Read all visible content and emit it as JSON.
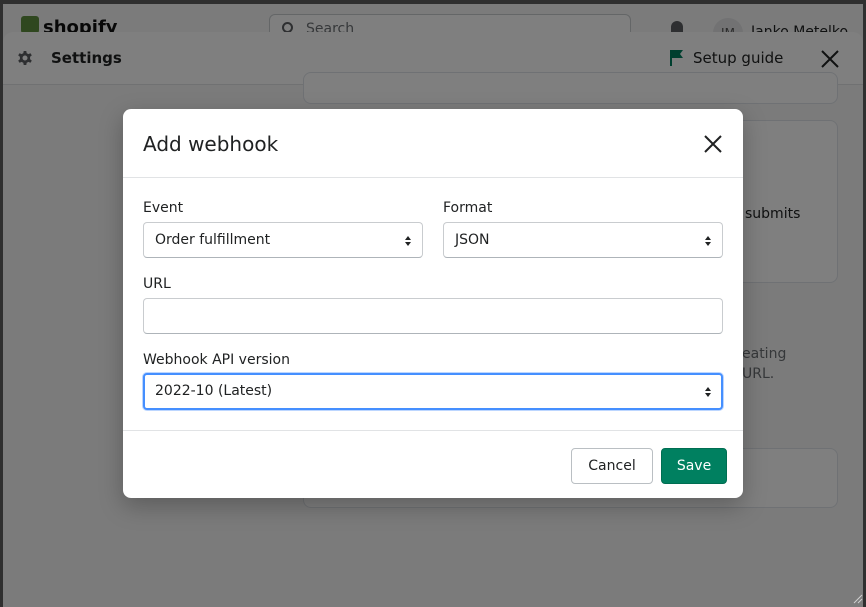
{
  "topbar": {
    "logo_text": "shopify",
    "search_placeholder": "Search",
    "avatar_initials": "JM",
    "user_name": "Janko Metelko"
  },
  "settings": {
    "title": "Settings",
    "setup_guide": "Setup guide",
    "background": {
      "card_text_1": "submits",
      "card_text_2_line1": "eating",
      "card_text_2_line2": "URL."
    }
  },
  "modal": {
    "title": "Add webhook",
    "event": {
      "label": "Event",
      "value": "Order fulfillment"
    },
    "format": {
      "label": "Format",
      "value": "JSON"
    },
    "url": {
      "label": "URL",
      "value": "",
      "placeholder": ""
    },
    "api_version": {
      "label": "Webhook API version",
      "value": "2022-10 (Latest)"
    },
    "cancel_label": "Cancel",
    "save_label": "Save"
  },
  "colors": {
    "primary": "#008060",
    "focus": "#458fff",
    "flag": "#007f5f"
  }
}
